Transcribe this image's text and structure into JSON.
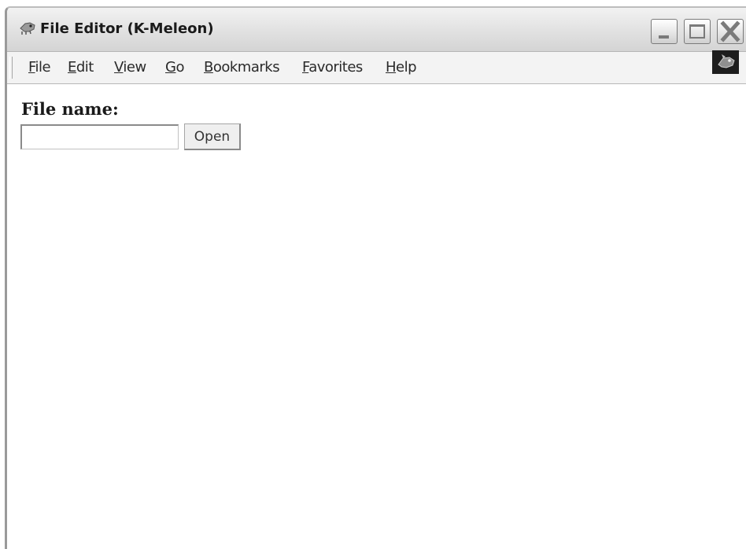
{
  "window": {
    "title": "File Editor (K-Meleon)",
    "icon": "k-meleon-app-icon",
    "controls": [
      "minimize-icon",
      "maximize-icon",
      "close-icon"
    ]
  },
  "menubar": {
    "items": [
      {
        "label": "File",
        "mnemonic": "F"
      },
      {
        "label": "Edit",
        "mnemonic": "E"
      },
      {
        "label": "View",
        "mnemonic": "V"
      },
      {
        "label": "Go",
        "mnemonic": "G"
      },
      {
        "label": "Bookmarks",
        "mnemonic": "B"
      },
      {
        "label": "Favorites",
        "mnemonic": "F"
      },
      {
        "label": "Help",
        "mnemonic": "H"
      }
    ],
    "throbber_icon": "chameleon-throbber-icon"
  },
  "form": {
    "file_name_label": "File name:",
    "file_name_value": "",
    "open_button_label": "Open"
  }
}
